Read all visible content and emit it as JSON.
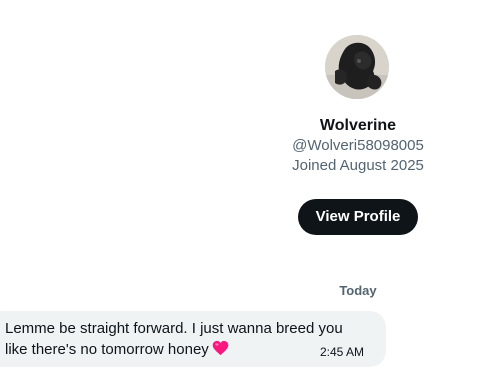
{
  "profile": {
    "name": "Wolverine",
    "handle": "@Wolveri58098005",
    "joined": "Joined August 2025",
    "view_button_label": "View Profile"
  },
  "conversation": {
    "day_separator": "Today",
    "messages": [
      {
        "line1": "Lemme be straight forward. I just wanna breed you",
        "line2": "like there's no tomorrow honey",
        "emoji": "pink-heart-icon",
        "time": "2:45 AM"
      }
    ]
  },
  "colors": {
    "primary_text": "#0f1419",
    "secondary_text": "#536471",
    "button_bg": "#0f1419",
    "bubble_bg": "#eff3f4",
    "heart": "#f91880"
  }
}
